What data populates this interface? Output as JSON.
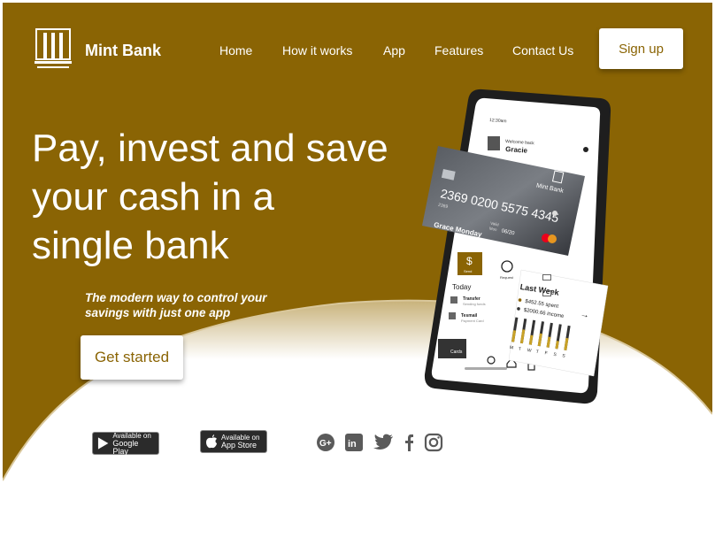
{
  "brand": {
    "name": "Mint Bank"
  },
  "nav": {
    "home": "Home",
    "how": "How it works",
    "app": "App",
    "features": "Features",
    "contact": "Contact Us"
  },
  "header": {
    "signup": "Sign up"
  },
  "hero": {
    "line1": "Pay, invest and save",
    "line2": "your cash in a",
    "line3": "single bank",
    "sub1": "The modern way to control your",
    "sub2": "savings with just one app",
    "cta": "Get started"
  },
  "stores": {
    "google_top": "Available on",
    "google_bottom": "Google Play",
    "apple_top": "Available on",
    "apple_bottom": "App Store"
  },
  "social": [
    "google-plus-icon",
    "linkedin-icon",
    "twitter-icon",
    "facebook-icon",
    "instagram-icon"
  ],
  "phone": {
    "time": "12:30am",
    "welcome": "Welcome back",
    "user": "Gracie",
    "send": "Send",
    "request": "Request",
    "today": "Today",
    "tx1_title": "Transfer",
    "tx1_sub": "Sending funds",
    "tx2_title": "Tesmail",
    "tx2_sub": "Payment Card",
    "cards": "Cards"
  },
  "card": {
    "number": "2369 0200 5575 4345",
    "small": "2369",
    "holder": "Grace Monday",
    "valid_label": "Valid",
    "valid_label2": "Mon",
    "valid": "06/20",
    "bank": "Mint Bank"
  },
  "week": {
    "title": "Last Week",
    "spent": "$452.55 spent",
    "income": "$2000.66 income",
    "days": [
      "M",
      "T",
      "W",
      "T",
      "F",
      "S",
      "S"
    ]
  },
  "colors": {
    "brand": "#8a6404",
    "white": "#ffffff"
  }
}
